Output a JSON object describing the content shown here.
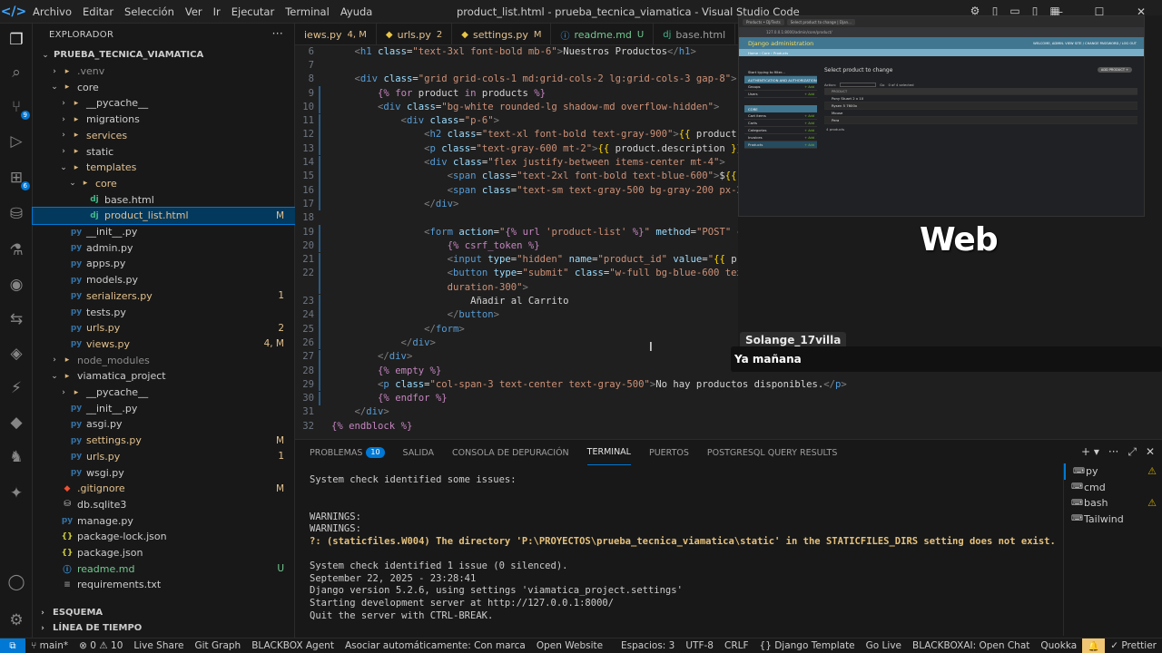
{
  "menu": [
    "Archivo",
    "Editar",
    "Selección",
    "Ver",
    "Ir",
    "Ejecutar",
    "Terminal",
    "Ayuda"
  ],
  "window_title": "product_list.html - prueba_tecnica_viamatica - Visual Studio Code",
  "sidebar": {
    "header": "EXPLORADOR",
    "tree": [
      {
        "label": "PRUEBA_TECNICA_VIAMATICA",
        "indent": 0,
        "arrow": "v",
        "icon": "",
        "status": "",
        "cls": "bold"
      },
      {
        "label": ".venv",
        "indent": 1,
        "arrow": ">",
        "icon": "folder",
        "status": "",
        "cls": "c-dim"
      },
      {
        "label": "core",
        "indent": 1,
        "arrow": "v",
        "icon": "folder",
        "status": "",
        "cls": ""
      },
      {
        "label": "__pycache__",
        "indent": 2,
        "arrow": ">",
        "icon": "folder",
        "status": "",
        "cls": ""
      },
      {
        "label": "migrations",
        "indent": 2,
        "arrow": ">",
        "icon": "folder",
        "status": "",
        "cls": ""
      },
      {
        "label": "services",
        "indent": 2,
        "arrow": ">",
        "icon": "folder",
        "status": "",
        "cls": "c-mod"
      },
      {
        "label": "static",
        "indent": 2,
        "arrow": ">",
        "icon": "folder",
        "status": "",
        "cls": ""
      },
      {
        "label": "templates",
        "indent": 2,
        "arrow": "v",
        "icon": "folder",
        "status": "",
        "cls": "c-mod"
      },
      {
        "label": "core",
        "indent": 3,
        "arrow": "v",
        "icon": "folder",
        "status": "",
        "cls": "c-mod"
      },
      {
        "label": "base.html",
        "indent": 4,
        "arrow": "",
        "icon": "dj",
        "status": "",
        "cls": ""
      },
      {
        "label": "product_list.html",
        "indent": 4,
        "arrow": "",
        "icon": "dj",
        "status": "M",
        "cls": "c-mod"
      },
      {
        "label": "__init__.py",
        "indent": 2,
        "arrow": "",
        "icon": "py",
        "status": "",
        "cls": ""
      },
      {
        "label": "admin.py",
        "indent": 2,
        "arrow": "",
        "icon": "py",
        "status": "",
        "cls": ""
      },
      {
        "label": "apps.py",
        "indent": 2,
        "arrow": "",
        "icon": "py",
        "status": "",
        "cls": ""
      },
      {
        "label": "models.py",
        "indent": 2,
        "arrow": "",
        "icon": "py",
        "status": "",
        "cls": ""
      },
      {
        "label": "serializers.py",
        "indent": 2,
        "arrow": "",
        "icon": "py",
        "status": "1",
        "cls": "c-mod"
      },
      {
        "label": "tests.py",
        "indent": 2,
        "arrow": "",
        "icon": "py",
        "status": "",
        "cls": ""
      },
      {
        "label": "urls.py",
        "indent": 2,
        "arrow": "",
        "icon": "py",
        "status": "2",
        "cls": "c-mod"
      },
      {
        "label": "views.py",
        "indent": 2,
        "arrow": "",
        "icon": "py",
        "status": "4, M",
        "cls": "c-mod"
      },
      {
        "label": "node_modules",
        "indent": 1,
        "arrow": ">",
        "icon": "folder",
        "status": "",
        "cls": "c-dim"
      },
      {
        "label": "viamatica_project",
        "indent": 1,
        "arrow": "v",
        "icon": "folder",
        "status": "",
        "cls": ""
      },
      {
        "label": "__pycache__",
        "indent": 2,
        "arrow": ">",
        "icon": "folder",
        "status": "",
        "cls": ""
      },
      {
        "label": "__init__.py",
        "indent": 2,
        "arrow": "",
        "icon": "py",
        "status": "",
        "cls": ""
      },
      {
        "label": "asgi.py",
        "indent": 2,
        "arrow": "",
        "icon": "py",
        "status": "",
        "cls": ""
      },
      {
        "label": "settings.py",
        "indent": 2,
        "arrow": "",
        "icon": "py",
        "status": "M",
        "cls": "c-mod"
      },
      {
        "label": "urls.py",
        "indent": 2,
        "arrow": "",
        "icon": "py",
        "status": "1",
        "cls": "c-mod"
      },
      {
        "label": "wsgi.py",
        "indent": 2,
        "arrow": "",
        "icon": "py",
        "status": "",
        "cls": ""
      },
      {
        "label": ".gitignore",
        "indent": 1,
        "arrow": "",
        "icon": "git",
        "status": "M",
        "cls": "c-mod"
      },
      {
        "label": "db.sqlite3",
        "indent": 1,
        "arrow": "",
        "icon": "db",
        "status": "",
        "cls": ""
      },
      {
        "label": "manage.py",
        "indent": 1,
        "arrow": "",
        "icon": "py",
        "status": "",
        "cls": ""
      },
      {
        "label": "package-lock.json",
        "indent": 1,
        "arrow": "",
        "icon": "json",
        "status": "",
        "cls": ""
      },
      {
        "label": "package.json",
        "indent": 1,
        "arrow": "",
        "icon": "json",
        "status": "",
        "cls": ""
      },
      {
        "label": "readme.md",
        "indent": 1,
        "arrow": "",
        "icon": "md",
        "status": "U",
        "cls": "c-untr"
      },
      {
        "label": "requirements.txt",
        "indent": 1,
        "arrow": "",
        "icon": "txt",
        "status": "",
        "cls": ""
      }
    ],
    "sections": [
      "ESQUEMA",
      "LÍNEA DE TIEMPO"
    ]
  },
  "tabs": [
    {
      "label": "iews.py",
      "marker": "4, M",
      "icon": "py"
    },
    {
      "label": "urls.py",
      "marker": "2",
      "icon": "py"
    },
    {
      "label": "settings.py",
      "marker": "M",
      "icon": "py"
    },
    {
      "label": "readme.md",
      "marker": "U",
      "icon": "md"
    },
    {
      "label": "base.html",
      "marker": "",
      "icon": "dj"
    }
  ],
  "code_lines": [
    {
      "n": "6",
      "html": "    <span class='tk-br'>&lt;</span><span class='tk-tag'>h1</span> <span class='tk-attr'>class</span>=<span class='tk-str'>\"text-3xl font-bold mb-6\"</span><span class='tk-br'>&gt;</span>Nuestros Productos<span class='tk-br'>&lt;/</span><span class='tk-tag'>h1</span><span class='tk-br'>&gt;</span>"
    },
    {
      "n": "7",
      "html": ""
    },
    {
      "n": "8",
      "html": "    <span class='tk-br'>&lt;</span><span class='tk-tag'>div</span> <span class='tk-attr'>class</span>=<span class='tk-str'>\"grid grid-cols-1 md:grid-cols-2 lg:grid-cols-3 gap-8\"</span><span class='tk-br'>&gt;</span>"
    },
    {
      "n": "9",
      "html": "        <span class='tk-tpl'>{%</span> <span class='tk-tpl'>for</span> product <span class='tk-tpl'>in</span> products <span class='tk-tpl'>%}</span>"
    },
    {
      "n": "10",
      "html": "        <span class='tk-br'>&lt;</span><span class='tk-tag'>div</span> <span class='tk-attr'>class</span>=<span class='tk-str'>\"bg-white rounded-lg shadow-md overflow-hidden\"</span><span class='tk-br'>&gt;</span>"
    },
    {
      "n": "11",
      "html": "            <span class='tk-br'>&lt;</span><span class='tk-tag'>div</span> <span class='tk-attr'>class</span>=<span class='tk-str'>\"p-6\"</span><span class='tk-br'>&gt;</span>"
    },
    {
      "n": "12",
      "html": "                <span class='tk-br'>&lt;</span><span class='tk-tag'>h2</span> <span class='tk-attr'>class</span>=<span class='tk-str'>\"text-xl font-bold text-gray-900\"</span><span class='tk-br'>&gt;</span><span class='tk-brace'>{{</span> product.name <span class='tk-brace'>}</span>"
    },
    {
      "n": "13",
      "html": "                <span class='tk-br'>&lt;</span><span class='tk-tag'>p</span> <span class='tk-attr'>class</span>=<span class='tk-str'>\"text-gray-600 mt-2\"</span><span class='tk-br'>&gt;</span><span class='tk-brace'>{{</span> product.description <span class='tk-brace'>}}</span><span class='tk-br'>&lt;/</span><span class='tk-tag'>p</span><span class='tk-br'>&gt;</span>"
    },
    {
      "n": "14",
      "html": "                <span class='tk-br'>&lt;</span><span class='tk-tag'>div</span> <span class='tk-attr'>class</span>=<span class='tk-str'>\"flex justify-between items-center mt-4\"</span><span class='tk-br'>&gt;</span>"
    },
    {
      "n": "15",
      "html": "                    <span class='tk-br'>&lt;</span><span class='tk-tag'>span</span> <span class='tk-attr'>class</span>=<span class='tk-str'>\"text-2xl font-bold text-blue-600\"</span><span class='tk-br'>&gt;</span>$<span class='tk-brace'>{{</span> produc"
    },
    {
      "n": "16",
      "html": "                    <span class='tk-br'>&lt;</span><span class='tk-tag'>span</span> <span class='tk-attr'>class</span>=<span class='tk-str'>\"text-sm text-gray-500 bg-gray-200 px-2 py-1</span>"
    },
    {
      "n": "17",
      "html": "                <span class='tk-br'>&lt;/</span><span class='tk-tag'>div</span><span class='tk-br'>&gt;</span>"
    },
    {
      "n": "18",
      "html": ""
    },
    {
      "n": "19",
      "html": "                <span class='tk-br'>&lt;</span><span class='tk-tag'>form</span> <span class='tk-attr'>action</span>=<span class='tk-str'>\"</span><span class='tk-tpl'>{%</span> <span class='tk-tpl'>url</span> <span class='tk-str'>'product-list'</span> <span class='tk-tpl'>%}</span><span class='tk-str'>\"</span> <span class='tk-attr'>method</span>=<span class='tk-str'>\"POST\"</span> <span class='tk-attr'>class</span>=<span class='tk-str'>\"</span>"
    },
    {
      "n": "20",
      "html": "                    <span class='tk-tpl'>{%</span> <span class='tk-tpl'>csrf_token</span> <span class='tk-tpl'>%}</span>"
    },
    {
      "n": "21",
      "html": "                    <span class='tk-br'>&lt;</span><span class='tk-tag'>input</span> <span class='tk-attr'>type</span>=<span class='tk-str'>\"hidden\"</span> <span class='tk-attr'>name</span>=<span class='tk-str'>\"product_id\"</span> <span class='tk-attr'>value</span>=<span class='tk-str'>\"</span><span class='tk-brace'>{{</span> product.id <span class='tk-brace'>}}</span><span class='tk-str'>\"</span><span class='tk-br'>&gt;</span>"
    },
    {
      "n": "22",
      "html": "                    <span class='tk-br'>&lt;</span><span class='tk-tag'>button</span> <span class='tk-attr'>type</span>=<span class='tk-str'>\"submit\"</span> <span class='tk-attr'>class</span>=<span class='tk-str'>\"w-full bg-blue-600 text-white font-bold py-2 px-4 rounded-lg hover:bg-blue-700 transition</span>"
    },
    {
      "n": "",
      "html": "                    <span class='tk-str'>duration-300\"</span><span class='tk-br'>&gt;</span>"
    },
    {
      "n": "23",
      "html": "                        Añadir al Carrito"
    },
    {
      "n": "24",
      "html": "                    <span class='tk-br'>&lt;/</span><span class='tk-tag'>button</span><span class='tk-br'>&gt;</span>"
    },
    {
      "n": "25",
      "html": "                <span class='tk-br'>&lt;/</span><span class='tk-tag'>form</span><span class='tk-br'>&gt;</span>"
    },
    {
      "n": "26",
      "html": "            <span class='tk-br'>&lt;/</span><span class='tk-tag'>div</span><span class='tk-br'>&gt;</span>"
    },
    {
      "n": "27",
      "html": "        <span class='tk-br'>&lt;/</span><span class='tk-tag'>div</span><span class='tk-br'>&gt;</span>"
    },
    {
      "n": "28",
      "html": "        <span class='tk-tpl'>{%</span> <span class='tk-tpl'>empty</span> <span class='tk-tpl'>%}</span>"
    },
    {
      "n": "29",
      "html": "        <span class='tk-br'>&lt;</span><span class='tk-tag'>p</span> <span class='tk-attr'>class</span>=<span class='tk-str'>\"col-span-3 text-center text-gray-500\"</span><span class='tk-br'>&gt;</span>No hay productos disponibles.<span class='tk-br'>&lt;/</span><span class='tk-tag'>p</span><span class='tk-br'>&gt;</span>"
    },
    {
      "n": "30",
      "html": "        <span class='tk-tpl'>{%</span> <span class='tk-tpl'>endfor</span> <span class='tk-tpl'>%}</span>"
    },
    {
      "n": "31",
      "html": "    <span class='tk-br'>&lt;/</span><span class='tk-tag'>div</span><span class='tk-br'>&gt;</span>"
    },
    {
      "n": "32",
      "html": "<span class='tk-tpl'>{%</span> <span class='tk-tpl'>endblock</span> <span class='tk-tpl'>%}</span>"
    }
  ],
  "browser": {
    "tabs": [
      "Products • DJ/Tests",
      "Select product to change | Djan..."
    ],
    "url": "127.0.0.1:8000/admin/core/product/",
    "django_title": "Django administration",
    "user_links": "WELCOME, ADMIN. VIEW SITE / CHANGE PASSWORD / LOG OUT",
    "breadcrumb": "Home › Core › Products",
    "side_filter": "Start typing to filter...",
    "side_auth": "AUTHENTICATION AND AUTHORIZATION",
    "side_auth_items": [
      "Groups",
      "Users"
    ],
    "side_core": "CORE",
    "side_core_items": [
      "Cart items",
      "Carts",
      "Categorias",
      "Invoices",
      "Products"
    ],
    "add_label": "+ Add",
    "main_title": "Select product to change",
    "add_button": "ADD PRODUCT +",
    "action_label": "Action:",
    "action_go": "Go",
    "action_selected": "0 of 4 selected",
    "column_header": "PRODUCT",
    "products": [
      "Pony Stuart 2 x 10",
      "Rysen 5 7600x",
      "Mouse",
      "Pera"
    ],
    "count": "4 products"
  },
  "overlay": {
    "web_text": "Web",
    "chat_user": "Solange_17villa",
    "chat_message": "Ya mañana"
  },
  "panel": {
    "tabs": [
      "PROBLEMAS",
      "SALIDA",
      "CONSOLA DE DEPURACIÓN",
      "TERMINAL",
      "PUERTOS",
      "POSTGRESQL QUERY RESULTS"
    ],
    "problems_count": "10",
    "terminal_lines": [
      {
        "t": "System check identified some issues:",
        "w": false
      },
      {
        "t": "",
        "w": false
      },
      {
        "t": "",
        "w": false
      },
      {
        "t": "WARNINGS:",
        "w": false
      },
      {
        "t": "WARNINGS:",
        "w": false
      },
      {
        "t": "?: (staticfiles.W004) The directory 'P:\\PROYECTOS\\prueba_tecnica_viamatica\\static' in the STATICFILES_DIRS setting does not exist.",
        "w": true
      },
      {
        "t": "",
        "w": false
      },
      {
        "t": "System check identified 1 issue (0 silenced).",
        "w": false
      },
      {
        "t": "September 22, 2025 - 23:28:41",
        "w": false
      },
      {
        "t": "Django version 5.2.6, using settings 'viamatica_project.settings'",
        "w": false
      },
      {
        "t": "Starting development server at http://127.0.0.1:8000/",
        "w": false
      },
      {
        "t": "Quit the server with CTRL-BREAK.",
        "w": false
      }
    ],
    "terminals": [
      {
        "label": "py",
        "warn": true
      },
      {
        "label": "cmd",
        "warn": false
      },
      {
        "label": "bash",
        "warn": true
      },
      {
        "label": "Tailwind",
        "warn": false
      }
    ]
  },
  "status": {
    "branch": "main*",
    "problems": "⊗ 0 ⚠ 10",
    "left_items": [
      "Live Share",
      "Git Graph",
      "BLACKBOX Agent",
      "Asociar automáticamente: Con marca",
      "Open Website"
    ],
    "right_items": [
      "Espacios: 3",
      "UTF-8",
      "CRLF",
      "{} Django Template",
      "Go Live",
      "BLACKBOXAI: Open Chat",
      "Quokka"
    ],
    "prettier": "✓ Prettier"
  }
}
